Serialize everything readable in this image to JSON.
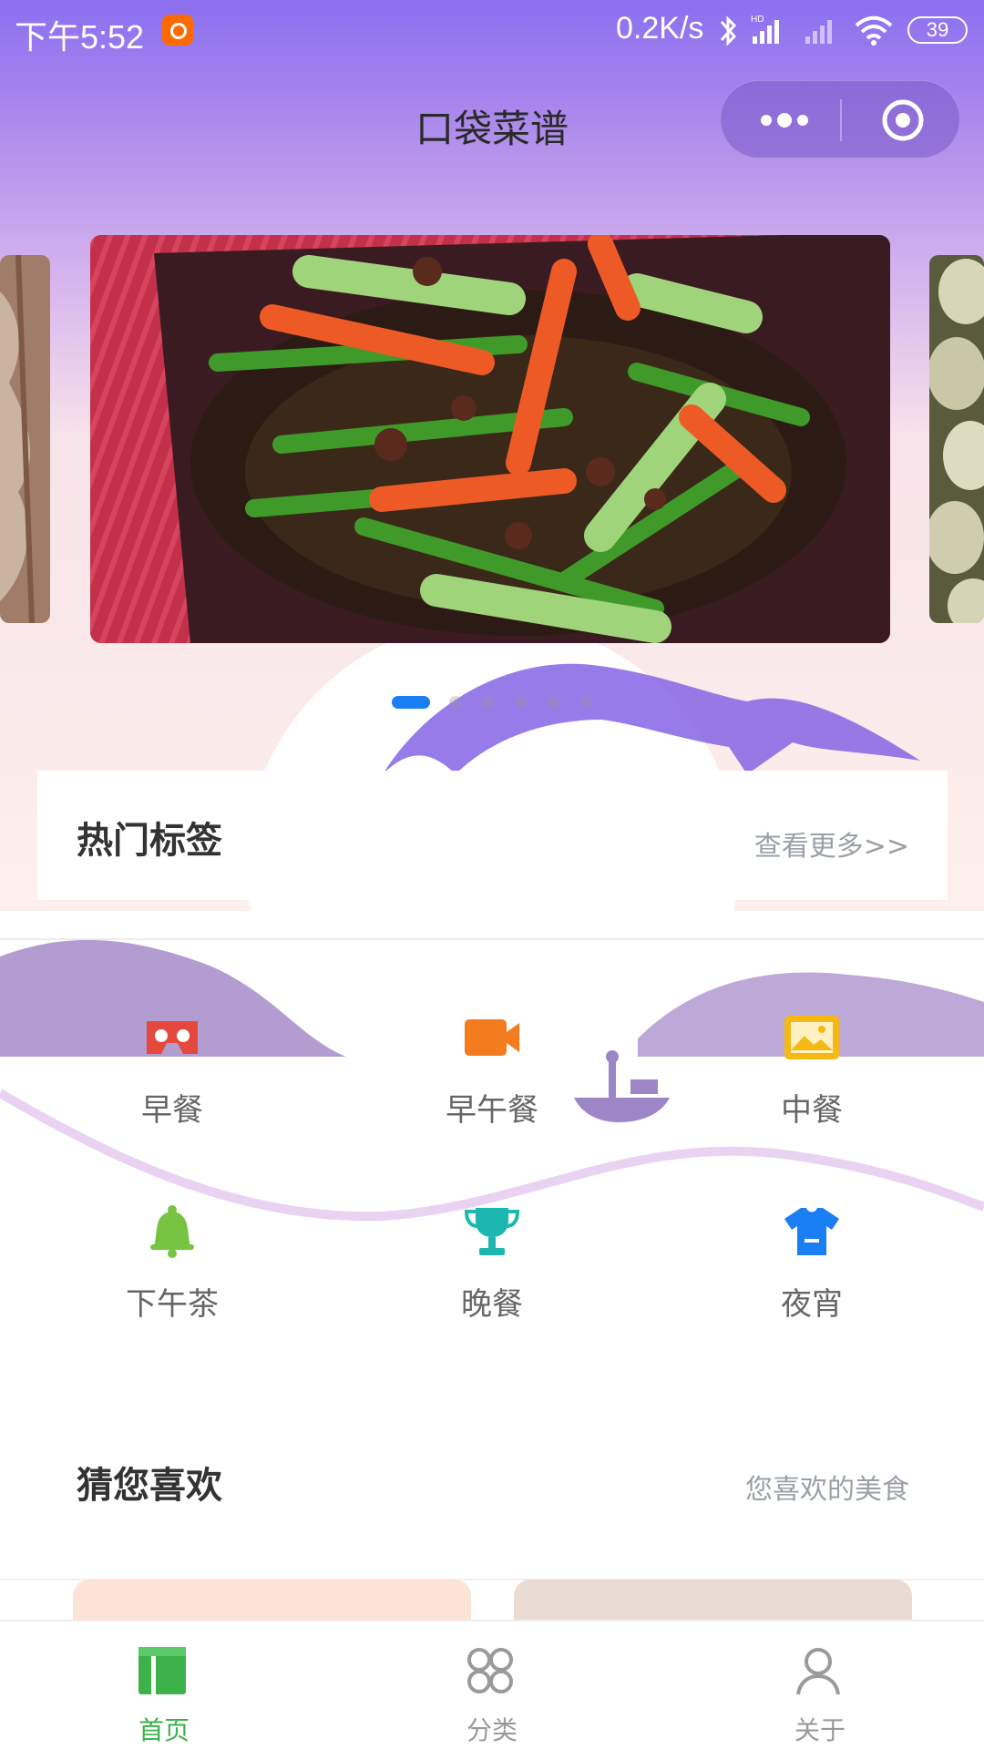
{
  "status_bar": {
    "time": "下午5:52",
    "speed": "0.2K/s",
    "battery": "39",
    "icons": [
      "app-notification-icon",
      "bluetooth-icon",
      "hd-signal-icon",
      "signal-icon",
      "wifi-icon",
      "battery-icon"
    ]
  },
  "header": {
    "title": "口袋菜谱",
    "capsule": {
      "more_icon": "more-dots-icon",
      "close_icon": "target-circle-icon"
    }
  },
  "banner": {
    "slide_count": 6,
    "active_index": 0,
    "indicator_color": "#1a7ef5"
  },
  "hot_tags": {
    "title": "热门标签",
    "more": "查看更多>>"
  },
  "categories": [
    {
      "label": "早餐",
      "icon": "vr-goggles-icon",
      "color": "#e5483c"
    },
    {
      "label": "早午餐",
      "icon": "video-camera-icon",
      "color": "#f47c1e"
    },
    {
      "label": "中餐",
      "icon": "image-icon",
      "color": "#f5b916"
    },
    {
      "label": "下午茶",
      "icon": "bell-icon",
      "color": "#76c442"
    },
    {
      "label": "晚餐",
      "icon": "trophy-icon",
      "color": "#1bb7b0"
    },
    {
      "label": "夜宵",
      "icon": "tshirt-icon",
      "color": "#1a7ef5"
    }
  ],
  "recommend": {
    "title": "猜您喜欢",
    "subtitle": "您喜欢的美食"
  },
  "tabbar": {
    "items": [
      {
        "label": "首页",
        "icon": "home-icon",
        "active": true
      },
      {
        "label": "分类",
        "icon": "category-icon",
        "active": false
      },
      {
        "label": "关于",
        "icon": "user-icon",
        "active": false
      }
    ],
    "active_color": "#3db24b"
  }
}
